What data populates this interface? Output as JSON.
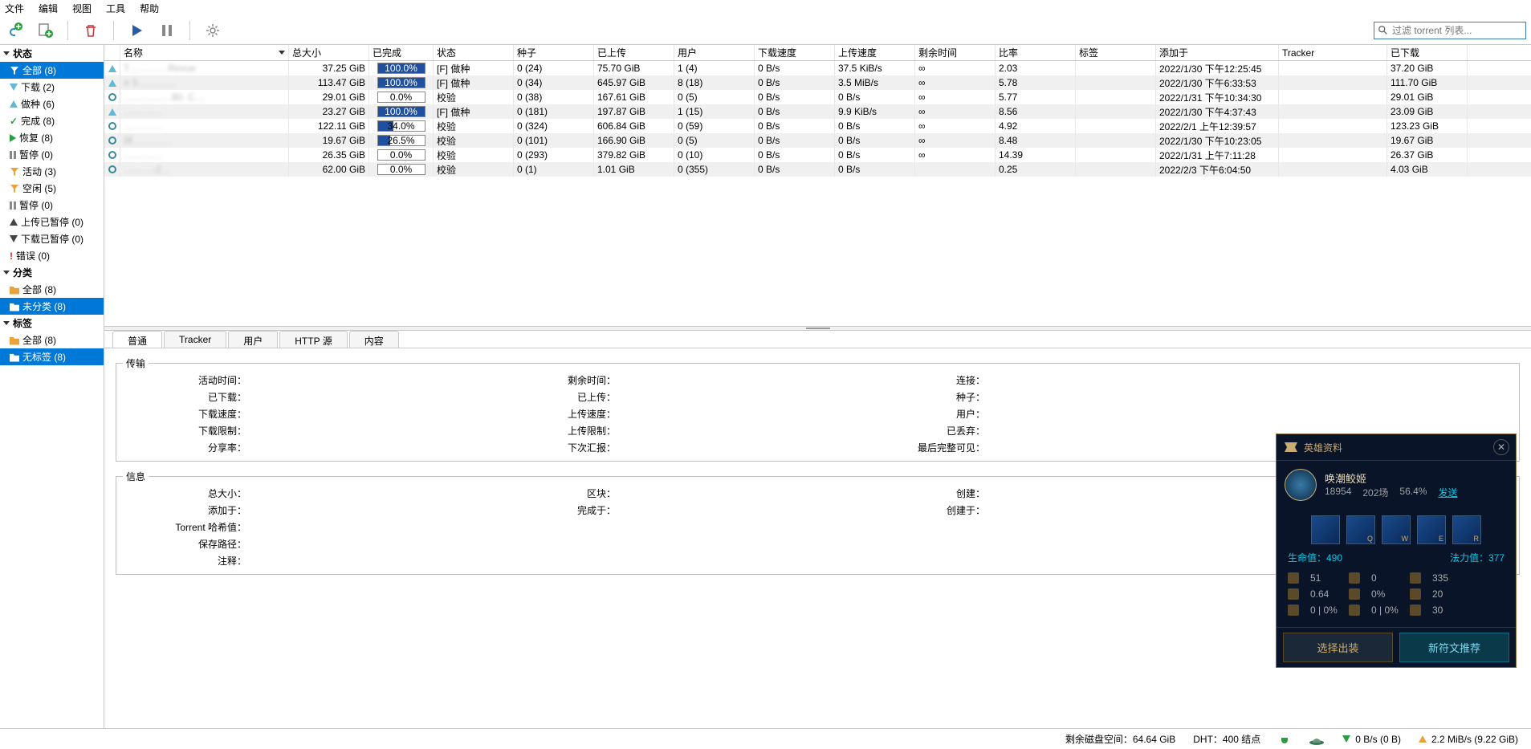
{
  "menu": {
    "file": "文件",
    "edit": "编辑",
    "view": "视图",
    "tools": "工具",
    "help": "帮助"
  },
  "filter_placeholder": "过滤 torrent 列表...",
  "sidebar": {
    "status_header": "状态",
    "status": [
      {
        "label": "全部 (8)",
        "icon": "filter"
      },
      {
        "label": "下载 (2)",
        "icon": "down"
      },
      {
        "label": "做种 (6)",
        "icon": "up"
      },
      {
        "label": "完成 (8)",
        "icon": "check"
      },
      {
        "label": "恢复 (8)",
        "icon": "play"
      },
      {
        "label": "暂停 (0)",
        "icon": "pause"
      },
      {
        "label": "活动 (3)",
        "icon": "filter"
      },
      {
        "label": "空闲 (5)",
        "icon": "filter"
      },
      {
        "label": "暂停 (0)",
        "icon": "pause"
      },
      {
        "label": "上传已暂停 (0)",
        "icon": "up-dark"
      },
      {
        "label": "下载已暂停 (0)",
        "icon": "down-dark"
      },
      {
        "label": "错误 (0)",
        "icon": "err"
      }
    ],
    "category_header": "分类",
    "category": [
      {
        "label": "全部 (8)",
        "icon": "folder"
      },
      {
        "label": "未分类 (8)",
        "icon": "folder",
        "sel": true
      }
    ],
    "tags_header": "标签",
    "tags": [
      {
        "label": "全部 (8)",
        "icon": "folder"
      },
      {
        "label": "无标签 (8)",
        "icon": "folder",
        "sel": true
      }
    ]
  },
  "columns": {
    "name": "名称",
    "size": "总大小",
    "progress": "已完成",
    "status": "状态",
    "seeds": "种子",
    "uploaded": "已上传",
    "peers": "用户",
    "dlspeed": "下载速度",
    "upspeed": "上传速度",
    "eta": "剩余时间",
    "ratio": "比率",
    "tags": "标签",
    "added": "添加于",
    "tracker": "Tracker",
    "downloaded": "已下载"
  },
  "torrents": [
    {
      "name": "T…………Revue",
      "size": "37.25 GiB",
      "pct": 100,
      "status": "[F] 做种",
      "seeds": "0 (24)",
      "up": "75.70 GiB",
      "peers": "1 (4)",
      "dl": "0 B/s",
      "ul": "37.5 KiB/s",
      "eta": "∞",
      "ratio": "2.03",
      "added": "2022/1/30 下午12:25:45",
      "dled": "37.20 GiB",
      "icon": "up-blue"
    },
    {
      "name": "e S…………",
      "size": "113.47 GiB",
      "pct": 100,
      "status": "[F] 做种",
      "seeds": "0 (34)",
      "up": "645.97 GiB",
      "peers": "8 (18)",
      "dl": "0 B/s",
      "ul": "3.5 MiB/s",
      "eta": "∞",
      "ratio": "5.78",
      "added": "2022/1/30 下午6:33:53",
      "dled": "111.70 GiB",
      "icon": "up-blue"
    },
    {
      "name": "……………80. C…",
      "size": "29.01 GiB",
      "pct": 0,
      "status": "校验",
      "seeds": "0 (38)",
      "up": "167.61 GiB",
      "peers": "0 (5)",
      "dl": "0 B/s",
      "ul": "0 B/s",
      "eta": "∞",
      "ratio": "5.77",
      "added": "2022/1/31 下午10:34:30",
      "dled": "29.01 GiB",
      "icon": "gear"
    },
    {
      "name": "…………",
      "size": "23.27 GiB",
      "pct": 100,
      "status": "[F] 做种",
      "seeds": "0 (181)",
      "up": "197.87 GiB",
      "peers": "1 (15)",
      "dl": "0 B/s",
      "ul": "9.9 KiB/s",
      "eta": "∞",
      "ratio": "8.56",
      "added": "2022/1/30 下午4:37:43",
      "dled": "23.09 GiB",
      "icon": "up-blue"
    },
    {
      "name": "…………",
      "size": "122.11 GiB",
      "pct": 34,
      "status": "校验",
      "seeds": "0 (324)",
      "up": "606.84 GiB",
      "peers": "0 (59)",
      "dl": "0 B/s",
      "ul": "0 B/s",
      "eta": "∞",
      "ratio": "4.92",
      "added": "2022/2/1 上午12:39:57",
      "dled": "123.23 GiB",
      "icon": "gear"
    },
    {
      "name": "环…………",
      "size": "19.67 GiB",
      "pct": 26.5,
      "status": "校验",
      "seeds": "0 (101)",
      "up": "166.90 GiB",
      "peers": "0 (5)",
      "dl": "0 B/s",
      "ul": "0 B/s",
      "eta": "∞",
      "ratio": "8.48",
      "added": "2022/1/30 下午10:23:05",
      "dled": "19.67 GiB",
      "icon": "gear"
    },
    {
      "name": "…………",
      "size": "26.35 GiB",
      "pct": 0,
      "status": "校验",
      "seeds": "0 (293)",
      "up": "379.82 GiB",
      "peers": "0 (10)",
      "dl": "0 B/s",
      "ul": "0 B/s",
      "eta": "∞",
      "ratio": "14.39",
      "added": "2022/1/31 上午7:11:28",
      "dled": "26.37 GiB",
      "icon": "gear"
    },
    {
      "name": "………-2…",
      "size": "62.00 GiB",
      "pct": 0,
      "status": "校验",
      "seeds": "0 (1)",
      "up": "1.01 GiB",
      "peers": "0 (355)",
      "dl": "0 B/s",
      "ul": "0 B/s",
      "eta": "",
      "ratio": "0.25",
      "added": "2022/2/3 下午6:04:50",
      "dled": "4.03 GiB",
      "icon": "gear"
    }
  ],
  "tabs": {
    "general": "普通",
    "trackers": "Tracker",
    "peers": "用户",
    "http": "HTTP 源",
    "content": "内容"
  },
  "detail": {
    "transfer_legend": "传输",
    "info_legend": "信息",
    "transfer_rows": [
      [
        "活动时间：",
        "",
        "剩余时间：",
        "",
        "连接："
      ],
      [
        "已下载：",
        "",
        "已上传：",
        "",
        "种子："
      ],
      [
        "下载速度：",
        "",
        "上传速度：",
        "",
        "用户："
      ],
      [
        "下载限制：",
        "",
        "上传限制：",
        "",
        "已丢弃："
      ],
      [
        "分享率：",
        "",
        "下次汇报：",
        "",
        "最后完整可见："
      ]
    ],
    "info_rows": [
      [
        "总大小：",
        "",
        "区块：",
        "",
        "创建："
      ],
      [
        "添加于：",
        "",
        "完成于：",
        "",
        "创建于："
      ],
      [
        "Torrent 哈希值：",
        "",
        "",
        "",
        ""
      ],
      [
        "保存路径：",
        "",
        "",
        "",
        ""
      ],
      [
        "注释：",
        "",
        "",
        "",
        ""
      ]
    ]
  },
  "statusbar": {
    "disk": "剩余磁盘空间：64.64 GiB",
    "dht": "DHT：400 结点",
    "dl": "0 B/s (0 B)",
    "ul": "2.2 MiB/s (9.22 GiB)"
  },
  "overlay": {
    "title": "英雄资料",
    "champ_name": "唤潮鲛姬",
    "stat1": "18954",
    "stat2": "202场",
    "stat3": "56.4%",
    "send": "发送",
    "keys": [
      "",
      "Q",
      "W",
      "E",
      "R"
    ],
    "hp_label": "生命值：490",
    "mp_label": "法力值：377",
    "stats": [
      [
        "51",
        "0",
        "335"
      ],
      [
        "0.64",
        "0%",
        "20"
      ],
      [
        "0 | 0%",
        "0 | 0%",
        "30"
      ]
    ],
    "btn1": "选择出装",
    "btn2": "新符文推荐"
  }
}
